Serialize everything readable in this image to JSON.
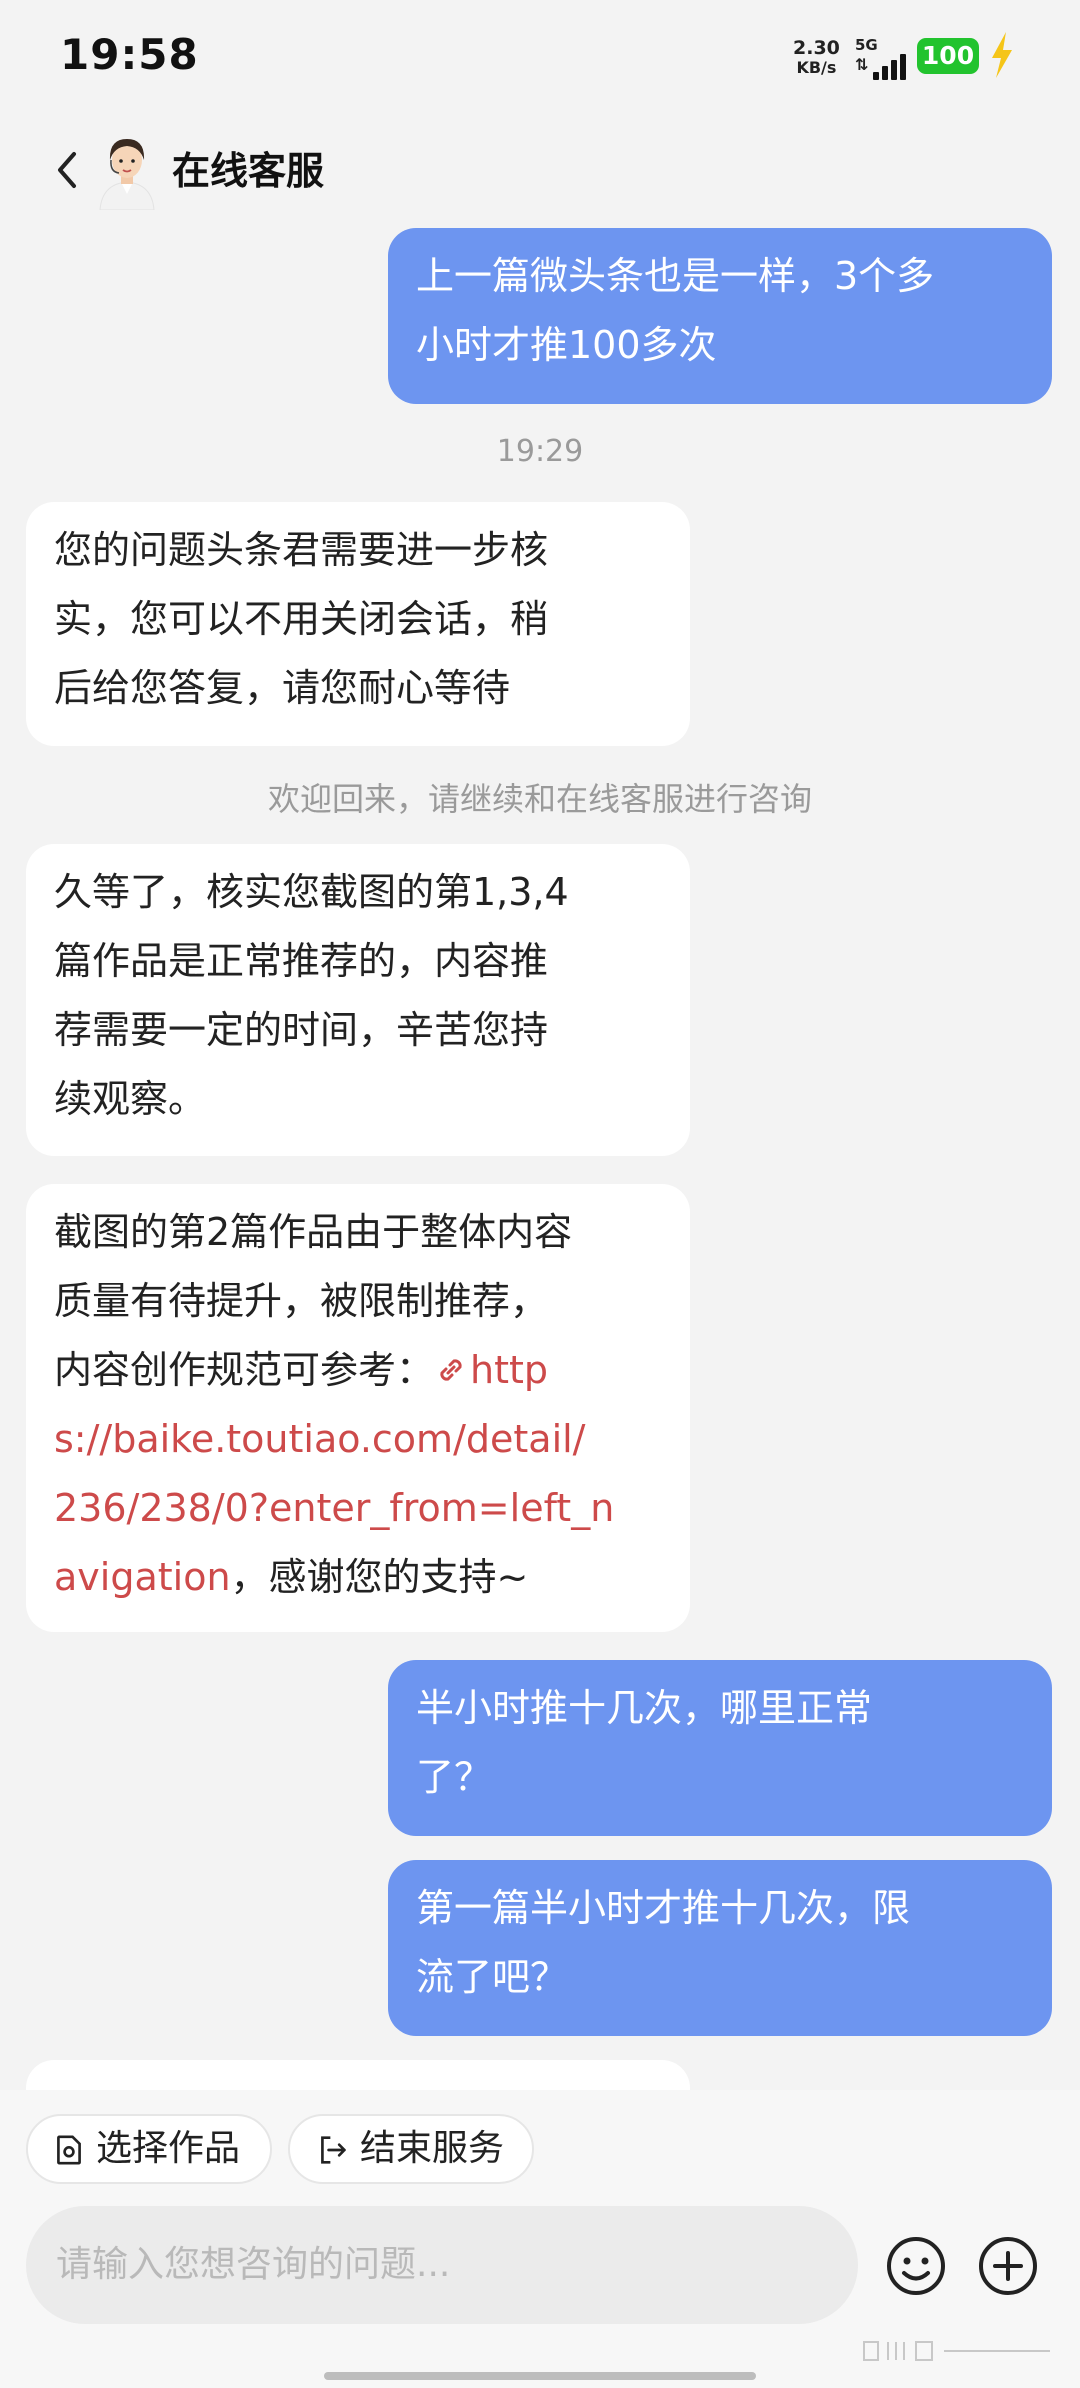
{
  "status_bar": {
    "time": "19:58",
    "net_speed_value": "2.30",
    "net_speed_unit": "KB/s",
    "network_type": "5G",
    "battery": "100"
  },
  "header": {
    "title": "在线客服"
  },
  "messages": [
    {
      "sender": "user",
      "text_lines": [
        "上一篇微头条也是一样，3个多",
        "小时才推100多次"
      ]
    },
    {
      "type": "timestamp",
      "text": "19:29"
    },
    {
      "sender": "agent",
      "text_lines": [
        "您的问题头条君需要进一步核",
        "实，您可以不用关闭会话，稍",
        "后给您答复，请您耐心等待"
      ]
    },
    {
      "type": "system_notice",
      "text": "欢迎回来，请继续和在线客服进行咨询"
    },
    {
      "sender": "agent",
      "text_lines": [
        "久等了，核实您截图的第1,3,4",
        "篇作品是正常推荐的，内容推",
        "荐需要一定的时间，辛苦您持",
        "续观察。"
      ]
    },
    {
      "sender": "agent",
      "text_lines": [
        "截图的第2篇作品由于整体内容",
        "质量有待提升，被限制推荐，"
      ],
      "line3_prefix": "内容创作规范可参考：",
      "link_lines": [
        "http",
        "s://baike.toutiao.com/detail/",
        "236/238/0?enter_from=left_n",
        "avigation"
      ],
      "suffix": "，感谢您的支持~"
    },
    {
      "sender": "user",
      "text_lines": [
        "半小时推十几次，哪里正常",
        "了？"
      ]
    },
    {
      "sender": "user",
      "text_lines": [
        "第一篇半小时才推十几次，限",
        "流了吧？"
      ]
    }
  ],
  "actions": {
    "select_work": "选择作品",
    "end_service": "结束服务"
  },
  "composer": {
    "placeholder": "请输入您想咨询的问题..."
  },
  "colors": {
    "user_bubble": "#6d95f0",
    "agent_bubble": "#ffffff",
    "link": "#cd4a4a",
    "battery": "#22c32e",
    "background": "#f3f3f3"
  },
  "icons": [
    "back-icon",
    "avatar",
    "link-icon",
    "select-work-icon",
    "end-service-icon",
    "emoji-icon",
    "plus-icon",
    "lightning-icon"
  ]
}
